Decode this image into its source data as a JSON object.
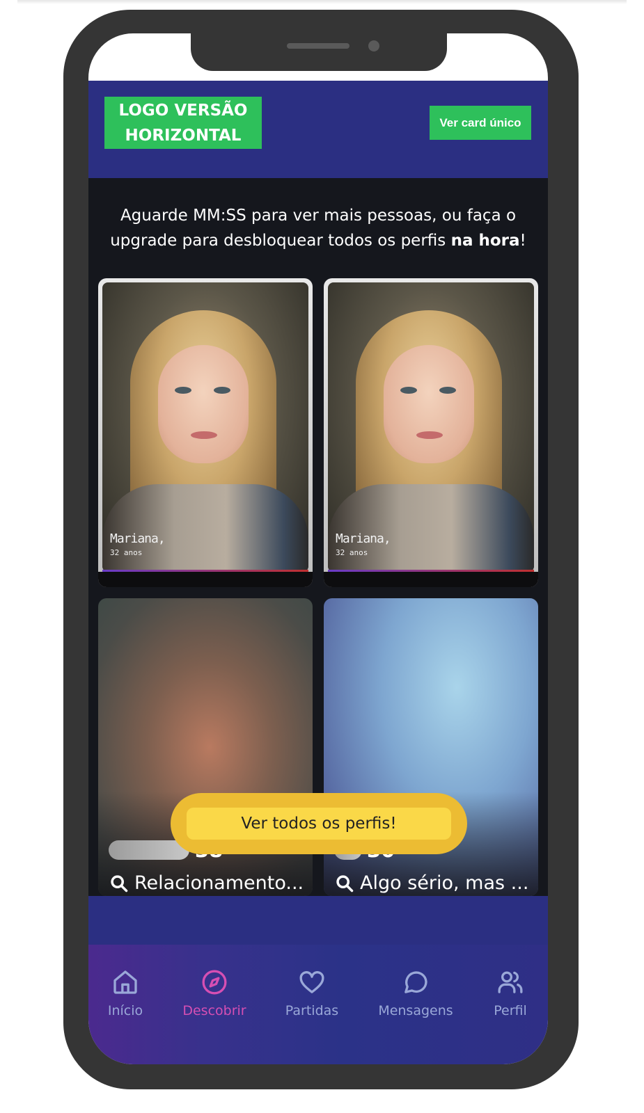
{
  "header": {
    "logo_text": "LOGO VERSÃO\nHORIZONTAL",
    "toggle_button": "Ver card único"
  },
  "notice": {
    "line1": "Aguarde MM:SS para ver mais pessoas, ou faça o",
    "line2_prefix": "upgrade para desbloquear todos os perfis ",
    "line2_bold": "na hora",
    "line2_suffix": "!"
  },
  "profiles": [
    {
      "name": "Mariana,",
      "age": "32 anos"
    },
    {
      "name": "Mariana,",
      "age": "32 anos"
    }
  ],
  "blurred_profiles": [
    {
      "age": "38",
      "intent": "Relacionamento..."
    },
    {
      "age": "30",
      "intent": "Algo sério, mas ..."
    }
  ],
  "cta": {
    "label": "Ver todos os perfis!"
  },
  "nav": {
    "items": [
      {
        "label": "Início",
        "icon": "home-icon"
      },
      {
        "label": "Descobrir",
        "icon": "compass-icon",
        "active": true
      },
      {
        "label": "Partidas",
        "icon": "heart-icon"
      },
      {
        "label": "Mensagens",
        "icon": "chat-bubble-icon"
      },
      {
        "label": "Perfil",
        "icon": "users-icon"
      }
    ]
  },
  "colors": {
    "header_bg": "#2b2f82",
    "brand_green": "#2ec05b",
    "cta_yellow": "#fad848",
    "nav_active": "#d64fb3",
    "nav_inactive": "#9aa8d8",
    "content_bg": "#15171d"
  }
}
